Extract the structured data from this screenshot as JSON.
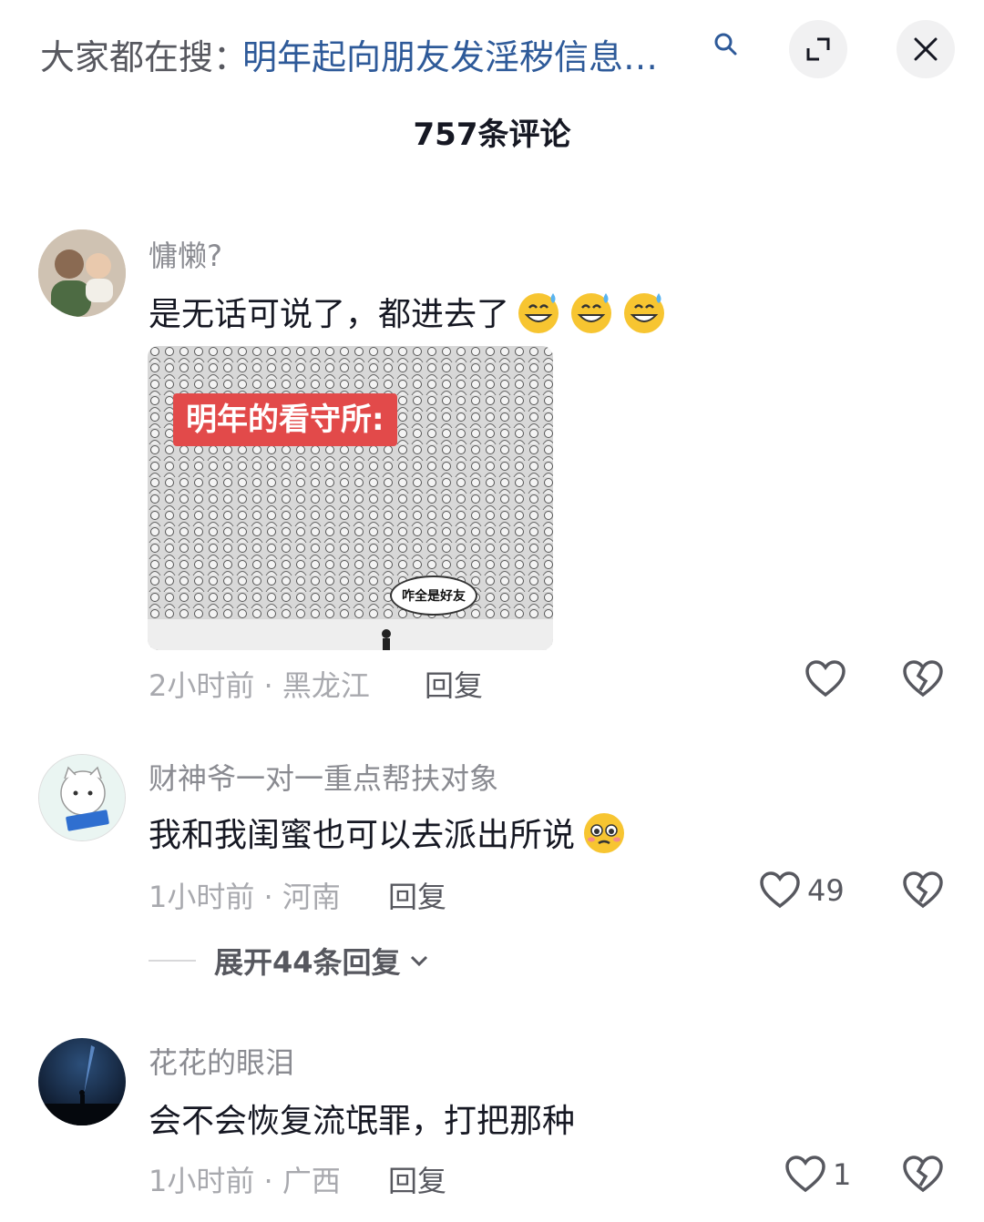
{
  "header": {
    "search_prefix": "大家都在搜：",
    "search_query": "明年起向朋友发淫秽信息…",
    "icons": {
      "search": "search-icon",
      "expand": "expand-icon",
      "close": "close-icon"
    }
  },
  "comment_count_label": "757条评论",
  "colors": {
    "link_blue": "#2e5a99",
    "muted_gray": "#a8a9ae",
    "banner_red": "#e24a4a"
  },
  "comments": [
    {
      "username": "慵懒?",
      "text": "是无话可说了，都进去了",
      "emojis": [
        "grin-sweat-emoji",
        "grin-sweat-emoji",
        "grin-sweat-emoji"
      ],
      "image": {
        "banner": "明年的看守所:",
        "bubble": "咋全是好友"
      },
      "time_location": "2小时前 · 黑龙江",
      "reply_label": "回复",
      "like_count": ""
    },
    {
      "username": "财神爷一对一重点帮扶对象",
      "text": "我和我闺蜜也可以去派出所说",
      "emojis": [
        "pleading-emoji"
      ],
      "time_location": "1小时前 · 河南",
      "reply_label": "回复",
      "like_count": "49",
      "expand_replies_label": "展开44条回复"
    },
    {
      "username": "花花的眼泪",
      "text": "会不会恢复流氓罪，打把那种",
      "time_location": "1小时前 · 广西",
      "reply_label": "回复",
      "like_count": "1"
    }
  ]
}
